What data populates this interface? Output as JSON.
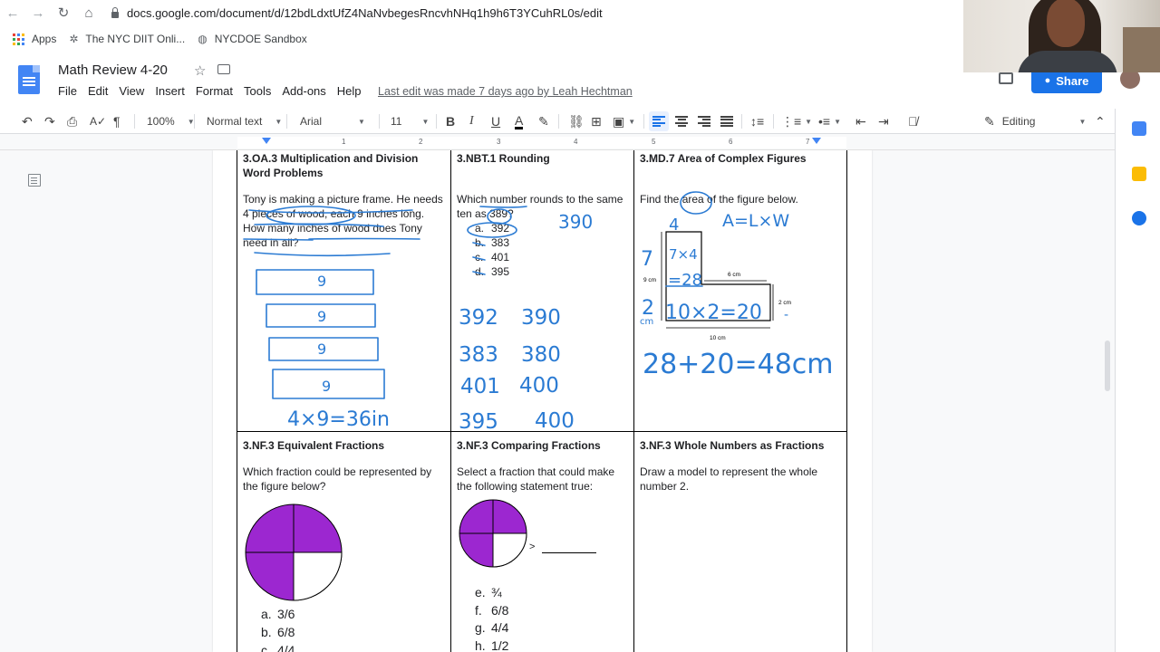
{
  "browser": {
    "url": "docs.google.com/document/d/12bdLdxtUfZ4NaNvbegesRncvhNHq1h9h6T3YCuhRL0s/edit",
    "bookmarks": [
      "Apps",
      "The NYC DIIT Onli...",
      "NYCDOE Sandbox"
    ]
  },
  "doc": {
    "title": "Math Review 4-20",
    "menu": [
      "File",
      "Edit",
      "View",
      "Insert",
      "Format",
      "Tools",
      "Add-ons",
      "Help"
    ],
    "last_edit": "Last edit was made 7 days ago by Leah Hechtman",
    "share_label": "Share"
  },
  "toolbar": {
    "zoom": "100%",
    "style": "Normal text",
    "font": "Arial",
    "size": "11",
    "mode": "Editing"
  },
  "ruler_numbers": [
    "1",
    "2",
    "3",
    "4",
    "5",
    "6",
    "7"
  ],
  "worksheet": {
    "row1": {
      "c1": {
        "header": "3.OA.3 Multiplication and Division Word Problems",
        "question": "Tony is making a picture frame. He needs 4 pieces of wood, each 9 inches long. How many inches of wood does Tony need in all?"
      },
      "c2": {
        "header": "3.NBT.1 Rounding",
        "question": "Which number rounds to the same ten as 389?",
        "options": [
          {
            "letter": "a.",
            "value": "392"
          },
          {
            "letter": "b.",
            "value": "383"
          },
          {
            "letter": "c.",
            "value": "401"
          },
          {
            "letter": "d.",
            "value": "395"
          }
        ]
      },
      "c3": {
        "header": "3.MD.7 Area of Complex Figures",
        "question": "Find the area of the figure below.",
        "labels": {
          "top_width": "6 cm",
          "left_height": "9 cm",
          "right_height": "2 cm",
          "bottom_width": "10 cm"
        }
      }
    },
    "row2": {
      "c1": {
        "header": "3.NF.3 Equivalent Fractions",
        "question": "Which fraction could be represented by the figure below?",
        "options": [
          {
            "letter": "a.",
            "value": "3/6"
          },
          {
            "letter": "b.",
            "value": "6/8"
          },
          {
            "letter": "c.",
            "value": "4/4"
          }
        ]
      },
      "c2": {
        "header": "3.NF.3 Comparing Fractions",
        "question": "Select a fraction that could make the following statement true:",
        "compare_sign": ">",
        "options": [
          {
            "letter": "e.",
            "value": "¾"
          },
          {
            "letter": "f.",
            "value": "6/8"
          },
          {
            "letter": "g.",
            "value": "4/4"
          },
          {
            "letter": "h.",
            "value": "1/2"
          }
        ]
      },
      "c3": {
        "header": "3.NF.3 Whole Numbers as Fractions",
        "question": "Draw a model to represent the whole number 2."
      }
    }
  },
  "annotations": {
    "frame_pieces": [
      "9",
      "9",
      "9",
      "9"
    ],
    "frame_answer": "4×9=36in",
    "round_answer": "390",
    "round_work": [
      [
        "392",
        "390"
      ],
      [
        "383",
        "380"
      ],
      [
        "401",
        "400"
      ],
      [
        "395",
        "400"
      ]
    ],
    "area_formula": "A=L×W",
    "area_top": "4",
    "area_left_top": "7",
    "area_left_bottom": "2",
    "area_unit": "cm",
    "area_calc1": "7×4",
    "area_calc1_result": "=28",
    "area_calc2": "10×2=20",
    "area_dash": "-",
    "area_total": "28+20=48cm"
  },
  "colors": {
    "ink": "#2b7bd3",
    "fraction_fill": "#9c27d0",
    "share": "#1a73e8"
  }
}
